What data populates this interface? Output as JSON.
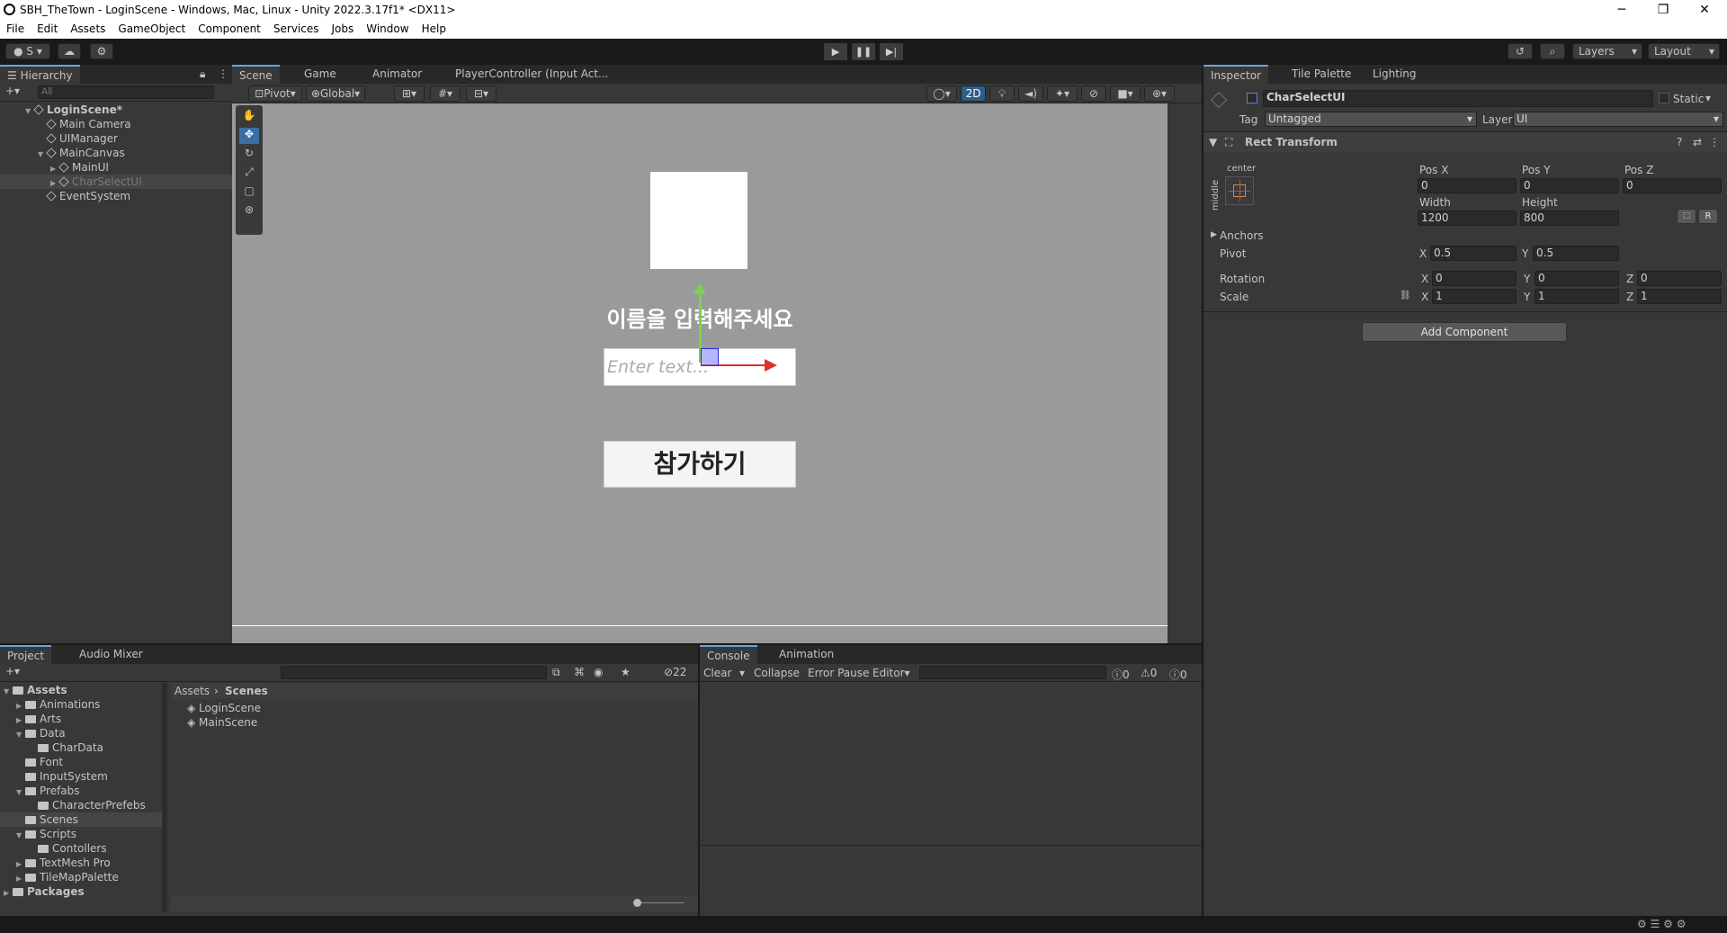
{
  "window": {
    "title": "SBH_TheTown - LoginScene - Windows, Mac, Linux - Unity 2022.3.17f1* <DX11>",
    "minimize": "─",
    "restore": "❐",
    "close": "✕"
  },
  "menu": [
    "File",
    "Edit",
    "Assets",
    "GameObject",
    "Component",
    "Services",
    "Jobs",
    "Window",
    "Help"
  ],
  "toolbar": {
    "account": "S",
    "play_icon": "play-icon",
    "pause_icon": "pause-icon",
    "step_icon": "step-icon",
    "layers": "Layers",
    "layout": "Layout"
  },
  "hierarchy": {
    "tab": "Hierarchy",
    "search_placeholder": "All",
    "items": [
      {
        "label": "LoginScene*",
        "indent": 0,
        "arrow": "▼",
        "bold": true
      },
      {
        "label": "Main Camera",
        "indent": 1,
        "arrow": ""
      },
      {
        "label": "UIManager",
        "indent": 1,
        "arrow": ""
      },
      {
        "label": "MainCanvas",
        "indent": 1,
        "arrow": "▼"
      },
      {
        "label": "MainUI",
        "indent": 2,
        "arrow": "▶"
      },
      {
        "label": "CharSelectUI",
        "indent": 2,
        "arrow": "▶",
        "selected": true,
        "dim": true
      },
      {
        "label": "EventSystem",
        "indent": 1,
        "arrow": ""
      }
    ]
  },
  "scene": {
    "tabs": [
      "Scene",
      "Game",
      "Animator",
      "PlayerController (Input Act..."
    ],
    "pivot": "Pivot",
    "global": "Global",
    "mode2d": "2D",
    "prompt_text": "이름을 입력해주세요",
    "input_placeholder": "Enter text...",
    "join_button": "참가하기"
  },
  "inspector": {
    "tabs": [
      "Inspector",
      "Tile Palette",
      "Lighting"
    ],
    "object_name": "CharSelectUI",
    "static_label": "Static",
    "tag_label": "Tag",
    "tag_value": "Untagged",
    "layer_label": "Layer",
    "layer_value": "UI",
    "component": "Rect Transform",
    "anchor_h": "center",
    "anchor_v": "middle",
    "posx_label": "Pos X",
    "posx": "0",
    "posy_label": "Pos Y",
    "posy": "0",
    "posz_label": "Pos Z",
    "posz": "0",
    "width_label": "Width",
    "width": "1200",
    "height_label": "Height",
    "height": "800",
    "anchors_label": "Anchors",
    "pivot_label": "Pivot",
    "pivot_x": "0.5",
    "pivot_y": "0.5",
    "rotation_label": "Rotation",
    "rot_x": "0",
    "rot_y": "0",
    "rot_z": "0",
    "scale_label": "Scale",
    "scale_x": "1",
    "scale_y": "1",
    "scale_z": "1",
    "add_component": "Add Component",
    "x": "X",
    "y": "Y",
    "z": "Z",
    "r": "R"
  },
  "project": {
    "tabs": [
      "Project",
      "Audio Mixer"
    ],
    "hidden_count": "22",
    "breadcrumb": [
      "Assets",
      "Scenes"
    ],
    "tree": [
      {
        "label": "Assets",
        "indent": 0,
        "arrow": "▼",
        "bold": true
      },
      {
        "label": "Animations",
        "indent": 1,
        "arrow": "▶"
      },
      {
        "label": "Arts",
        "indent": 1,
        "arrow": "▶"
      },
      {
        "label": "Data",
        "indent": 1,
        "arrow": "▼"
      },
      {
        "label": "CharData",
        "indent": 2,
        "arrow": ""
      },
      {
        "label": "Font",
        "indent": 1,
        "arrow": ""
      },
      {
        "label": "InputSystem",
        "indent": 1,
        "arrow": ""
      },
      {
        "label": "Prefabs",
        "indent": 1,
        "arrow": "▼"
      },
      {
        "label": "CharacterPrefebs",
        "indent": 2,
        "arrow": ""
      },
      {
        "label": "Scenes",
        "indent": 1,
        "arrow": "",
        "selected": true
      },
      {
        "label": "Scripts",
        "indent": 1,
        "arrow": "▼"
      },
      {
        "label": "Contollers",
        "indent": 2,
        "arrow": ""
      },
      {
        "label": "TextMesh Pro",
        "indent": 1,
        "arrow": "▶"
      },
      {
        "label": "TileMapPalette",
        "indent": 1,
        "arrow": "▶"
      },
      {
        "label": "Packages",
        "indent": 0,
        "arrow": "▶",
        "bold": true
      }
    ],
    "files": [
      "LoginScene",
      "MainScene"
    ]
  },
  "console": {
    "tabs": [
      "Console",
      "Animation"
    ],
    "clear": "Clear",
    "collapse": "Collapse",
    "error_pause": "Error Pause",
    "editor": "Editor",
    "count_info": "0",
    "count_warn": "0",
    "count_error": "0"
  }
}
